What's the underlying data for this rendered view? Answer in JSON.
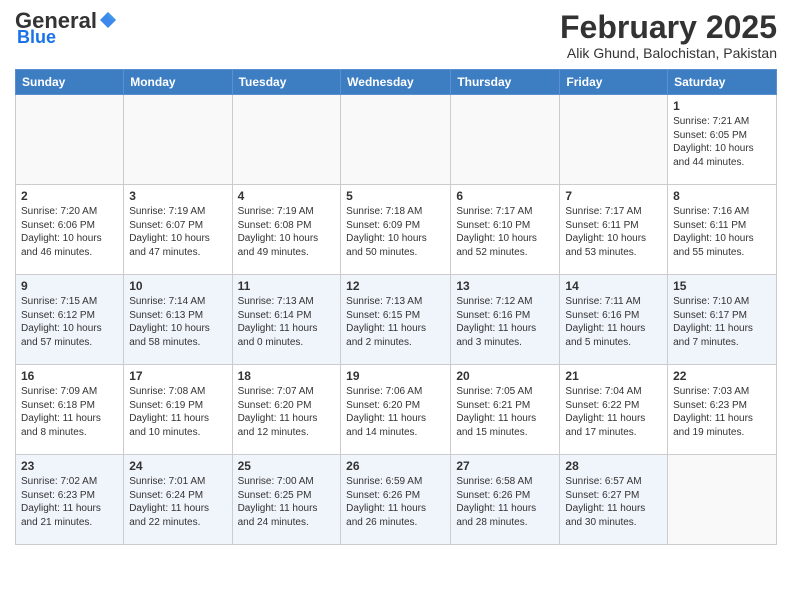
{
  "app": {
    "logo_general": "General",
    "logo_blue": "Blue",
    "title": "February 2025",
    "subtitle": "Alik Ghund, Balochistan, Pakistan"
  },
  "calendar": {
    "headers": [
      "Sunday",
      "Monday",
      "Tuesday",
      "Wednesday",
      "Thursday",
      "Friday",
      "Saturday"
    ],
    "weeks": [
      [
        {
          "day": "",
          "info": ""
        },
        {
          "day": "",
          "info": ""
        },
        {
          "day": "",
          "info": ""
        },
        {
          "day": "",
          "info": ""
        },
        {
          "day": "",
          "info": ""
        },
        {
          "day": "",
          "info": ""
        },
        {
          "day": "1",
          "info": "Sunrise: 7:21 AM\nSunset: 6:05 PM\nDaylight: 10 hours\nand 44 minutes."
        }
      ],
      [
        {
          "day": "2",
          "info": "Sunrise: 7:20 AM\nSunset: 6:06 PM\nDaylight: 10 hours\nand 46 minutes."
        },
        {
          "day": "3",
          "info": "Sunrise: 7:19 AM\nSunset: 6:07 PM\nDaylight: 10 hours\nand 47 minutes."
        },
        {
          "day": "4",
          "info": "Sunrise: 7:19 AM\nSunset: 6:08 PM\nDaylight: 10 hours\nand 49 minutes."
        },
        {
          "day": "5",
          "info": "Sunrise: 7:18 AM\nSunset: 6:09 PM\nDaylight: 10 hours\nand 50 minutes."
        },
        {
          "day": "6",
          "info": "Sunrise: 7:17 AM\nSunset: 6:10 PM\nDaylight: 10 hours\nand 52 minutes."
        },
        {
          "day": "7",
          "info": "Sunrise: 7:17 AM\nSunset: 6:11 PM\nDaylight: 10 hours\nand 53 minutes."
        },
        {
          "day": "8",
          "info": "Sunrise: 7:16 AM\nSunset: 6:11 PM\nDaylight: 10 hours\nand 55 minutes."
        }
      ],
      [
        {
          "day": "9",
          "info": "Sunrise: 7:15 AM\nSunset: 6:12 PM\nDaylight: 10 hours\nand 57 minutes."
        },
        {
          "day": "10",
          "info": "Sunrise: 7:14 AM\nSunset: 6:13 PM\nDaylight: 10 hours\nand 58 minutes."
        },
        {
          "day": "11",
          "info": "Sunrise: 7:13 AM\nSunset: 6:14 PM\nDaylight: 11 hours\nand 0 minutes."
        },
        {
          "day": "12",
          "info": "Sunrise: 7:13 AM\nSunset: 6:15 PM\nDaylight: 11 hours\nand 2 minutes."
        },
        {
          "day": "13",
          "info": "Sunrise: 7:12 AM\nSunset: 6:16 PM\nDaylight: 11 hours\nand 3 minutes."
        },
        {
          "day": "14",
          "info": "Sunrise: 7:11 AM\nSunset: 6:16 PM\nDaylight: 11 hours\nand 5 minutes."
        },
        {
          "day": "15",
          "info": "Sunrise: 7:10 AM\nSunset: 6:17 PM\nDaylight: 11 hours\nand 7 minutes."
        }
      ],
      [
        {
          "day": "16",
          "info": "Sunrise: 7:09 AM\nSunset: 6:18 PM\nDaylight: 11 hours\nand 8 minutes."
        },
        {
          "day": "17",
          "info": "Sunrise: 7:08 AM\nSunset: 6:19 PM\nDaylight: 11 hours\nand 10 minutes."
        },
        {
          "day": "18",
          "info": "Sunrise: 7:07 AM\nSunset: 6:20 PM\nDaylight: 11 hours\nand 12 minutes."
        },
        {
          "day": "19",
          "info": "Sunrise: 7:06 AM\nSunset: 6:20 PM\nDaylight: 11 hours\nand 14 minutes."
        },
        {
          "day": "20",
          "info": "Sunrise: 7:05 AM\nSunset: 6:21 PM\nDaylight: 11 hours\nand 15 minutes."
        },
        {
          "day": "21",
          "info": "Sunrise: 7:04 AM\nSunset: 6:22 PM\nDaylight: 11 hours\nand 17 minutes."
        },
        {
          "day": "22",
          "info": "Sunrise: 7:03 AM\nSunset: 6:23 PM\nDaylight: 11 hours\nand 19 minutes."
        }
      ],
      [
        {
          "day": "23",
          "info": "Sunrise: 7:02 AM\nSunset: 6:23 PM\nDaylight: 11 hours\nand 21 minutes."
        },
        {
          "day": "24",
          "info": "Sunrise: 7:01 AM\nSunset: 6:24 PM\nDaylight: 11 hours\nand 22 minutes."
        },
        {
          "day": "25",
          "info": "Sunrise: 7:00 AM\nSunset: 6:25 PM\nDaylight: 11 hours\nand 24 minutes."
        },
        {
          "day": "26",
          "info": "Sunrise: 6:59 AM\nSunset: 6:26 PM\nDaylight: 11 hours\nand 26 minutes."
        },
        {
          "day": "27",
          "info": "Sunrise: 6:58 AM\nSunset: 6:26 PM\nDaylight: 11 hours\nand 28 minutes."
        },
        {
          "day": "28",
          "info": "Sunrise: 6:57 AM\nSunset: 6:27 PM\nDaylight: 11 hours\nand 30 minutes."
        },
        {
          "day": "",
          "info": ""
        }
      ]
    ]
  }
}
